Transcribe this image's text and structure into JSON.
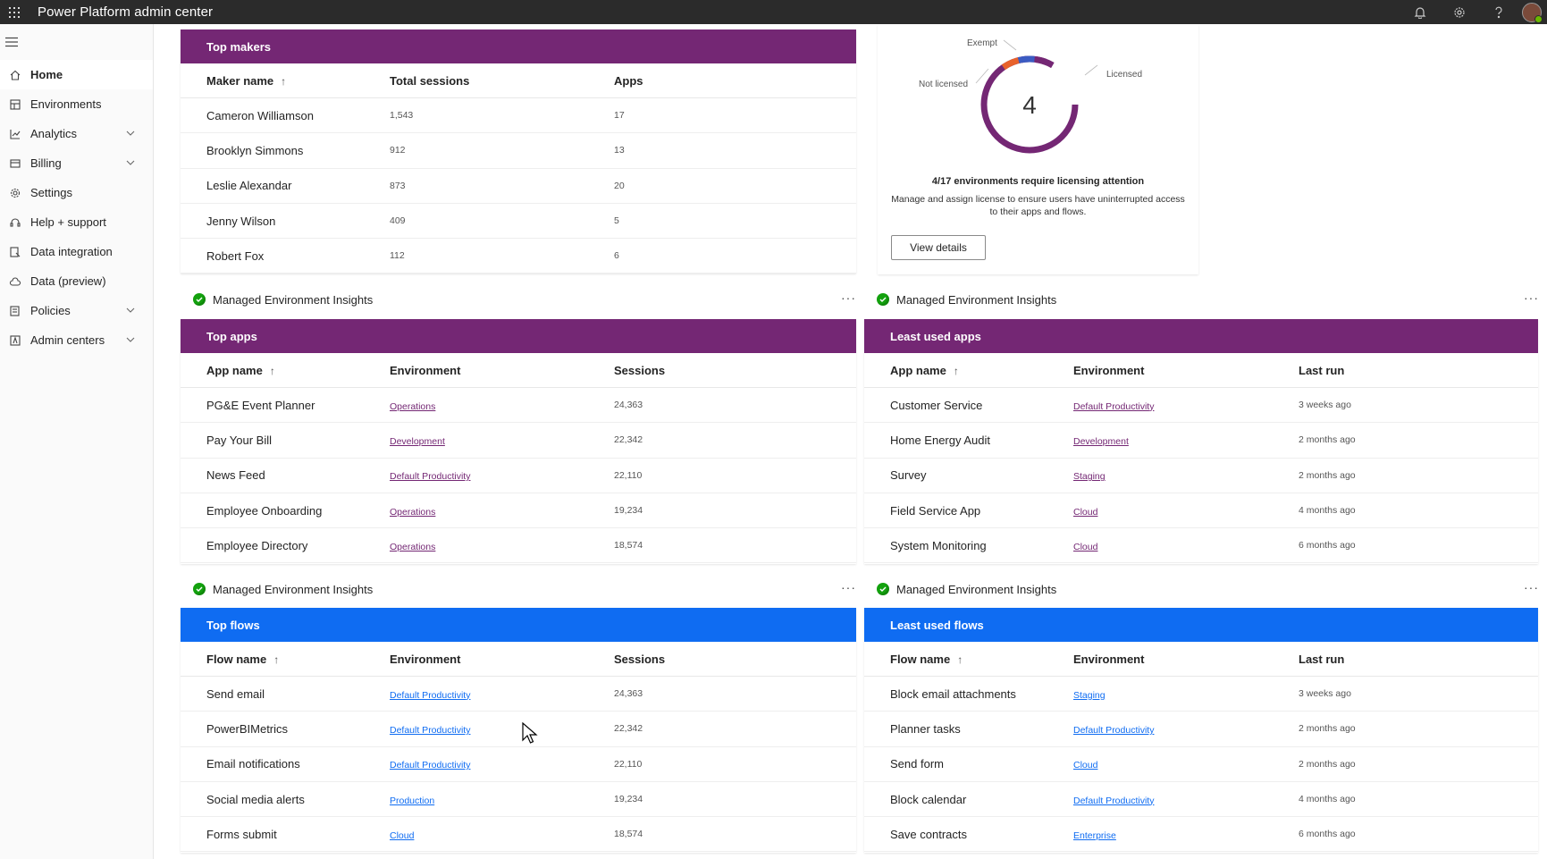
{
  "header": {
    "app_title": "Power Platform admin center"
  },
  "sidebar": {
    "items": [
      {
        "label": "Home",
        "icon": "home-icon",
        "active": true,
        "expandable": false
      },
      {
        "label": "Environments",
        "icon": "environments-icon",
        "expandable": false
      },
      {
        "label": "Analytics",
        "icon": "analytics-icon",
        "expandable": true
      },
      {
        "label": "Billing",
        "icon": "billing-icon",
        "expandable": true
      },
      {
        "label": "Settings",
        "icon": "gear-icon",
        "expandable": false
      },
      {
        "label": "Help + support",
        "icon": "headset-icon",
        "expandable": false
      },
      {
        "label": "Data integration",
        "icon": "data-integration-icon",
        "expandable": false
      },
      {
        "label": "Data (preview)",
        "icon": "cloud-icon",
        "expandable": false
      },
      {
        "label": "Policies",
        "icon": "policies-icon",
        "expandable": true
      },
      {
        "label": "Admin centers",
        "icon": "admin-centers-icon",
        "expandable": true
      }
    ]
  },
  "top_makers": {
    "title": "Top makers",
    "columns": [
      "Maker name",
      "Total sessions",
      "Apps"
    ],
    "rows": [
      [
        "Cameron Williamson",
        "1,543",
        "17"
      ],
      [
        "Brooklyn Simmons",
        "912",
        "13"
      ],
      [
        "Leslie Alexandar",
        "873",
        "20"
      ],
      [
        "Jenny Wilson",
        "409",
        "5"
      ],
      [
        "Robert Fox",
        "112",
        "6"
      ]
    ]
  },
  "licensing": {
    "center_value": "4",
    "labels": {
      "exempt": "Exempt",
      "not_licensed": "Not licensed",
      "licensed": "Licensed"
    },
    "title": "4/17 environments require licensing attention",
    "description": "Manage and assign license to ensure users have uninterrupted access to their apps and flows.",
    "button": "View details",
    "colors": {
      "licensed": "#742774",
      "exempt": "#3b5bc2",
      "not_licensed": "#e8622c"
    }
  },
  "section_title": "Managed Environment Insights",
  "more_label": "···",
  "top_apps": {
    "title": "Top apps",
    "columns": [
      "App name",
      "Environment",
      "Sessions"
    ],
    "rows": [
      [
        "PG&E Event Planner",
        "Operations",
        "24,363"
      ],
      [
        "Pay Your Bill",
        "Development",
        "22,342"
      ],
      [
        "News Feed",
        "Default Productivity",
        "22,110"
      ],
      [
        "Employee Onboarding",
        "Operations",
        "19,234"
      ],
      [
        "Employee Directory",
        "Operations",
        "18,574"
      ]
    ]
  },
  "least_used_apps": {
    "title": "Least used apps",
    "columns": [
      "App name",
      "Environment",
      "Last run"
    ],
    "rows": [
      [
        "Customer Service",
        "Default Productivity",
        "3 weeks ago"
      ],
      [
        "Home Energy Audit",
        "Development",
        "2 months ago"
      ],
      [
        "Survey",
        "Staging",
        "2 months ago"
      ],
      [
        "Field Service App",
        "Cloud",
        "4 months ago"
      ],
      [
        "System Monitoring",
        "Cloud",
        "6 months ago"
      ]
    ]
  },
  "top_flows": {
    "title": "Top flows",
    "columns": [
      "Flow name",
      "Environment",
      "Sessions"
    ],
    "rows": [
      [
        "Send email",
        "Default Productivity",
        "24,363"
      ],
      [
        "PowerBIMetrics",
        "Default Productivity",
        "22,342"
      ],
      [
        "Email notifications",
        "Default Productivity",
        "22,110"
      ],
      [
        "Social media alerts",
        "Production",
        "19,234"
      ],
      [
        "Forms submit",
        "Cloud",
        "18,574"
      ]
    ]
  },
  "least_used_flows": {
    "title": "Least used flows",
    "columns": [
      "Flow name",
      "Environment",
      "Last run"
    ],
    "rows": [
      [
        "Block email attachments",
        "Staging",
        "3 weeks ago"
      ],
      [
        "Planner tasks",
        "Default Productivity",
        "2 months ago"
      ],
      [
        "Send form",
        "Cloud",
        "2 months ago"
      ],
      [
        "Block calendar",
        "Default Productivity",
        "4 months ago"
      ],
      [
        "Save contracts",
        "Enterprise",
        "6 months ago"
      ]
    ]
  },
  "colors": {
    "purple_band": "#742774",
    "blue_band": "#0f6cf2",
    "check_green": "#13a10e"
  }
}
